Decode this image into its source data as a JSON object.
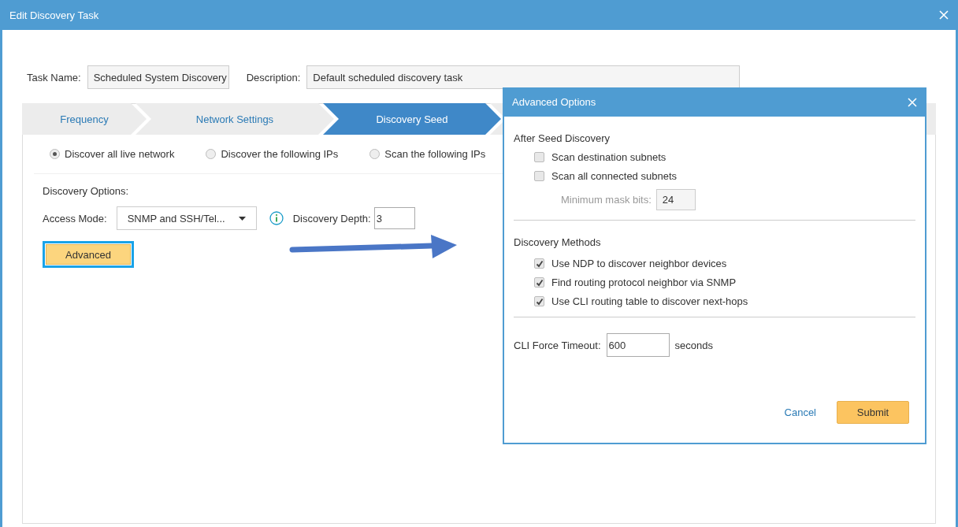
{
  "window": {
    "title": "Edit Discovery Task"
  },
  "task_name": {
    "label": "Task Name:",
    "value": "Scheduled System Discovery"
  },
  "description": {
    "label": "Description:",
    "value": "Default scheduled discovery task"
  },
  "tabs": [
    {
      "label": "Frequency",
      "selected": false
    },
    {
      "label": "Network Settings",
      "selected": false
    },
    {
      "label": "Discovery Seed",
      "selected": true
    }
  ],
  "seed_modes": [
    {
      "label": "Discover all live network",
      "selected": true
    },
    {
      "label": "Discover the following IPs",
      "selected": false
    },
    {
      "label": "Scan the following IPs",
      "selected": false
    }
  ],
  "discovery_options": {
    "heading": "Discovery Options:",
    "access_mode": {
      "label": "Access Mode:",
      "value": "SNMP and SSH/Tel..."
    },
    "depth": {
      "label": "Discovery Depth:",
      "value": "3"
    }
  },
  "advanced_button": {
    "label": "Advanced"
  },
  "advanced_dialog": {
    "title": "Advanced Options",
    "after_seed": {
      "heading": "After Seed Discovery",
      "options": [
        {
          "label": "Scan destination subnets",
          "checked": false
        },
        {
          "label": "Scan all connected subnets",
          "checked": false
        }
      ],
      "mask_bits": {
        "label": "Minimum mask bits:",
        "value": "24",
        "disabled": true
      }
    },
    "methods": {
      "heading": "Discovery Methods",
      "options": [
        {
          "label": "Use NDP to discover neighbor devices",
          "checked": true
        },
        {
          "label": "Find routing protocol neighbor via SNMP",
          "checked": true
        },
        {
          "label": "Use CLI routing table to discover next-hops",
          "checked": true
        }
      ]
    },
    "timeout": {
      "label": "CLI Force Timeout:",
      "value": "600",
      "unit": "seconds"
    },
    "cancel": "Cancel",
    "submit": "Submit"
  }
}
